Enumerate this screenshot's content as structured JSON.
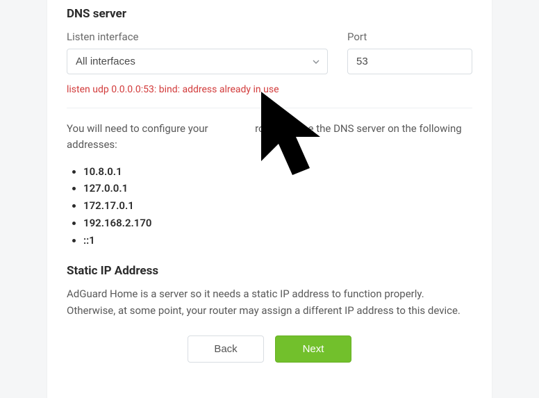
{
  "sections": {
    "dns": {
      "title": "DNS server",
      "listen_label": "Listen interface",
      "listen_value": "All interfaces",
      "port_label": "Port",
      "port_value": "53",
      "error": "listen udp 0.0.0.0:53: bind: address already in use",
      "help_pre": "You will need to configure your ",
      "help_gap": "",
      "help_post": " router to use the DNS server on the following addresses:",
      "addresses": [
        "10.8.0.1",
        "127.0.0.1",
        "172.17.0.1",
        "192.168.2.170",
        "::1"
      ]
    },
    "static_ip": {
      "title": "Static IP Address",
      "help": "AdGuard Home is a server so it needs a static IP address to function properly. Otherwise, at some point, your router may assign a different IP address to this device."
    }
  },
  "buttons": {
    "back": "Back",
    "next": "Next"
  }
}
